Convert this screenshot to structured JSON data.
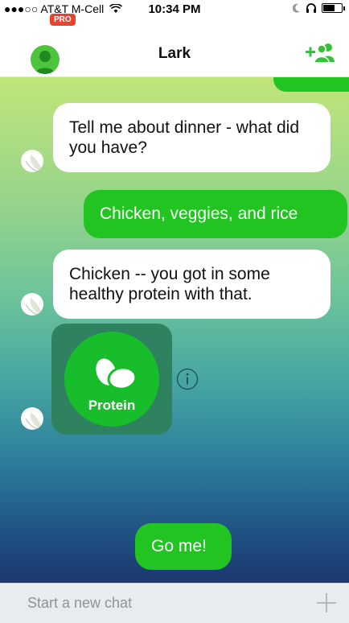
{
  "status_bar": {
    "carrier": "●●●○○ AT&T M-Cell",
    "time": "10:34 PM"
  },
  "nav": {
    "title": "Lark",
    "pro_badge": "PRO"
  },
  "messages": [
    {
      "from": "bot",
      "text": "Tell me about dinner - what did you have?"
    },
    {
      "from": "user",
      "text": "Chicken, veggies, and rice"
    },
    {
      "from": "bot",
      "text": "Chicken -- you got in some healthy protein with that."
    },
    {
      "from": "user",
      "text": "Go me!"
    }
  ],
  "badge_card": {
    "label": "Protein"
  },
  "composer": {
    "placeholder": "Start a new chat"
  },
  "colors": {
    "brand_green": "#21c421",
    "pro_red": "#e8432f",
    "card_green": "#2e8260"
  },
  "icons": [
    "wifi-icon",
    "moon-icon",
    "headphones-icon",
    "battery-icon",
    "profile-avatar-icon",
    "add-friend-icon",
    "lark-bot-icon",
    "egg-icon",
    "info-icon",
    "plus-icon"
  ]
}
